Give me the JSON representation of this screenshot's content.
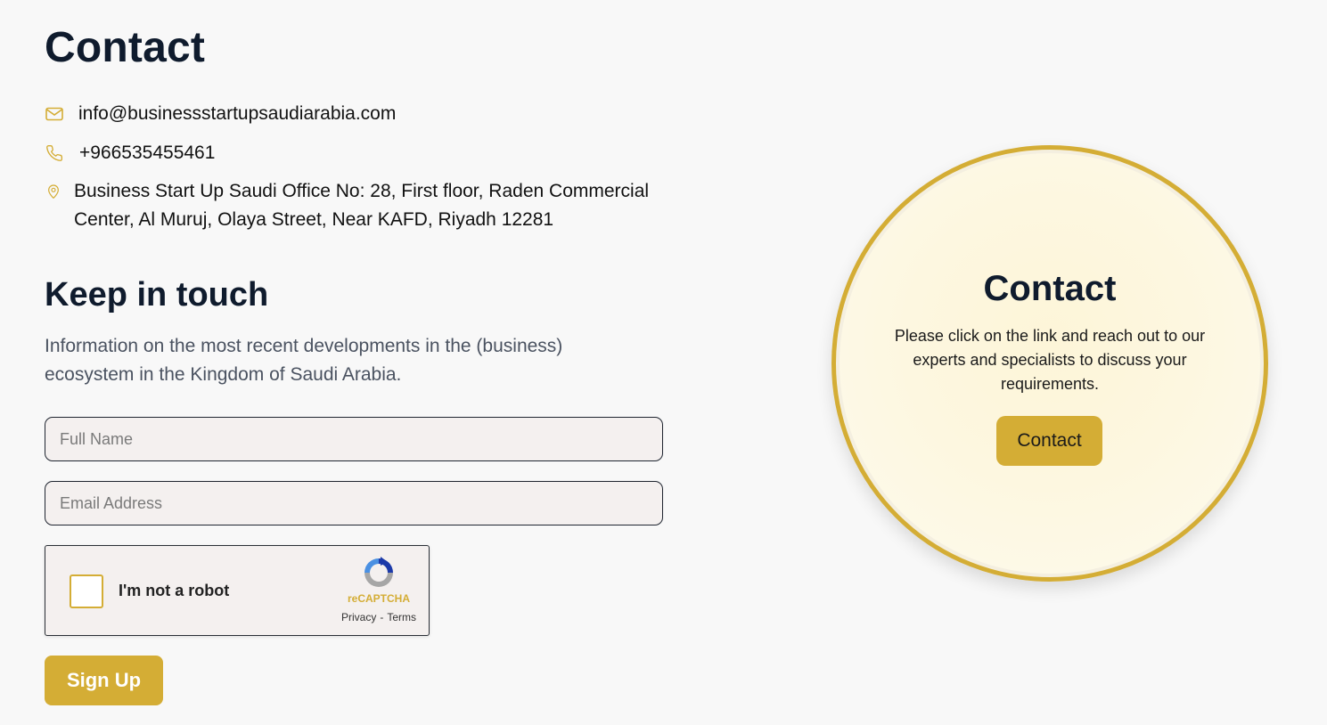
{
  "contact": {
    "title": "Contact",
    "email": "info@businessstartupsaudiarabia.com",
    "phone": "+966535455461",
    "address": "Business Start Up Saudi Office No: 28, First floor, Raden Commercial Center, Al Muruj, Olaya Street, Near KAFD, Riyadh 12281"
  },
  "newsletter": {
    "title": "Keep in touch",
    "description": "Information on the most recent developments in the (business) ecosystem in the Kingdom of Saudi Arabia.",
    "full_name_placeholder": "Full Name",
    "email_placeholder": "Email Address",
    "signup_label": "Sign Up"
  },
  "captcha": {
    "label": "I'm not a robot",
    "brand": "reCAPTCHA",
    "privacy": "Privacy",
    "separator": "-",
    "terms": "Terms"
  },
  "cta": {
    "title": "Contact",
    "description": "Please click on the link and reach out to our experts and specialists to discuss your requirements.",
    "button_label": "Contact"
  },
  "icons": {
    "email": "mail-icon",
    "phone": "phone-icon",
    "address": "map-pin-icon",
    "captcha": "recaptcha-logo-icon"
  },
  "colors": {
    "accent": "#d4ad35",
    "heading": "#0f1b2d",
    "background": "#f8f8f8",
    "input_bg": "#f4f0ef"
  }
}
